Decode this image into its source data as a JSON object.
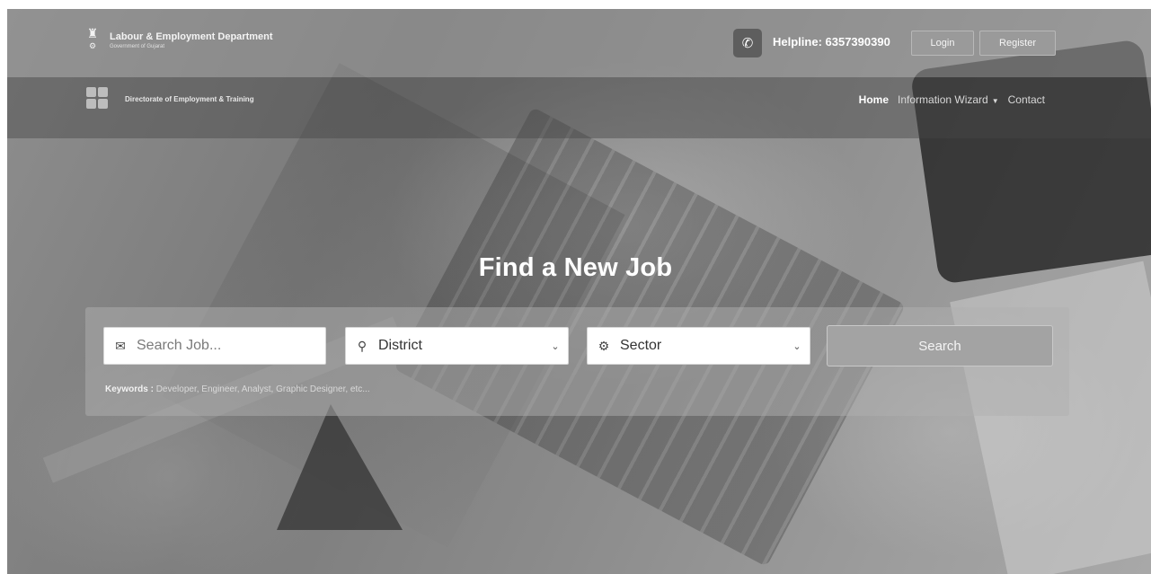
{
  "topbar": {
    "dept_title": "Labour & Employment Department",
    "dept_subtitle": "Government of Gujarat",
    "helpline": "Helpline: 6357390390",
    "login_label": "Login",
    "register_label": "Register"
  },
  "navbar": {
    "org_title": "Directorate of Employment & Training",
    "links": [
      "Home",
      "Information Wizard",
      "Contact"
    ]
  },
  "hero": {
    "title": "Find a New Job"
  },
  "search": {
    "job_placeholder": "Search Job...",
    "district_value": "District",
    "sector_value": "Sector",
    "button_label": "Search",
    "keywords_label": "Keywords :",
    "keywords_text": "Developer, Engineer, Analyst, Graphic Designer, etc..."
  },
  "icons": {
    "phone": "phone-icon",
    "briefcase": "briefcase-icon",
    "pin": "map-pin-icon",
    "gear": "gear-icon",
    "chevron": "chevron-down-icon"
  }
}
